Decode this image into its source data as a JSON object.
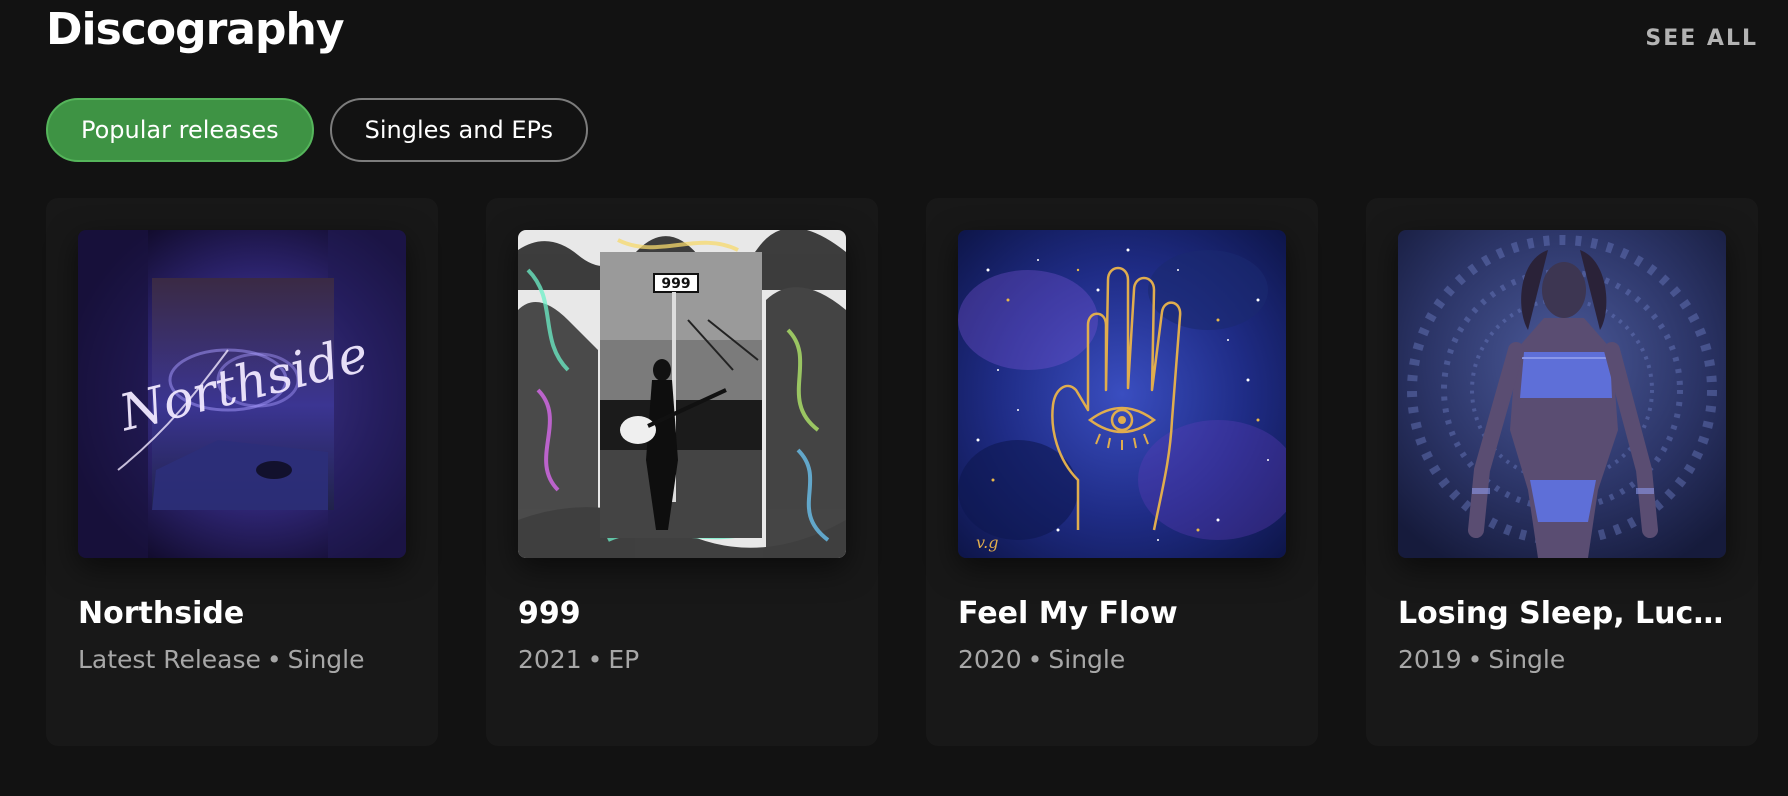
{
  "header": {
    "title": "Discography",
    "see_all": "SEE ALL"
  },
  "filters": [
    {
      "label": "Popular releases",
      "active": true
    },
    {
      "label": "Singles and EPs",
      "active": false
    }
  ],
  "colors": {
    "background": "#121212",
    "card": "#181818",
    "accent_green": "#3e9344",
    "muted_text": "#a7a7a7"
  },
  "releases": [
    {
      "title": "Northside",
      "meta_left": "Latest Release",
      "separator": "•",
      "meta_right": "Single",
      "cover_icon": "northside-cover-art",
      "cover_text": "Northside"
    },
    {
      "title": "999",
      "meta_left": "2021",
      "separator": "•",
      "meta_right": "EP",
      "cover_icon": "999-cover-art",
      "cover_text": "999"
    },
    {
      "title": "Feel My Flow",
      "meta_left": "2020",
      "separator": "•",
      "meta_right": "Single",
      "cover_icon": "feel-my-flow-cover-art",
      "cover_text": "v.g"
    },
    {
      "title": "Losing Sleep, Lucid ...",
      "meta_left": "2019",
      "separator": "•",
      "meta_right": "Single",
      "cover_icon": "losing-sleep-cover-art"
    }
  ]
}
